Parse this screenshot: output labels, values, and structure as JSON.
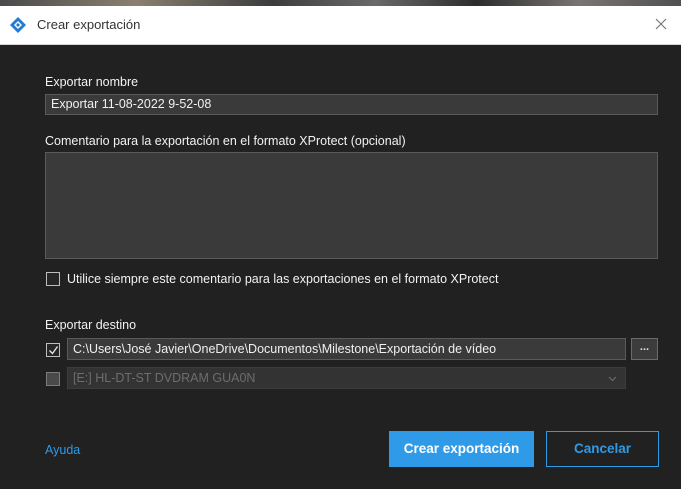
{
  "window": {
    "title": "Crear exportación",
    "app_icon": "milestone-diamond-icon",
    "close_icon": "close-icon"
  },
  "form": {
    "name_label": "Exportar nombre",
    "name_value": "Exportar 11-08-2022 9-52-08",
    "comment_label": "Comentario para la exportación en el formato XProtect (opcional)",
    "comment_value": "",
    "always_use_comment_label": "Utilice siempre este comentario para las exportaciones en el formato XProtect",
    "always_use_comment_checked": false
  },
  "destination": {
    "label": "Exportar destino",
    "items": [
      {
        "checked": true,
        "path": "C:\\Users\\José Javier\\OneDrive\\Documentos\\Milestone\\Exportación de vídeo",
        "browse_label": "..."
      },
      {
        "checked": false,
        "disabled": true,
        "drive": "[E:] HL-DT-ST DVDRAM GUA0N"
      }
    ]
  },
  "footer": {
    "help_label": "Ayuda",
    "primary_label": "Crear exportación",
    "cancel_label": "Cancelar"
  },
  "colors": {
    "accent": "#2f9be8",
    "background": "#212121",
    "field": "#3a3a3a"
  }
}
